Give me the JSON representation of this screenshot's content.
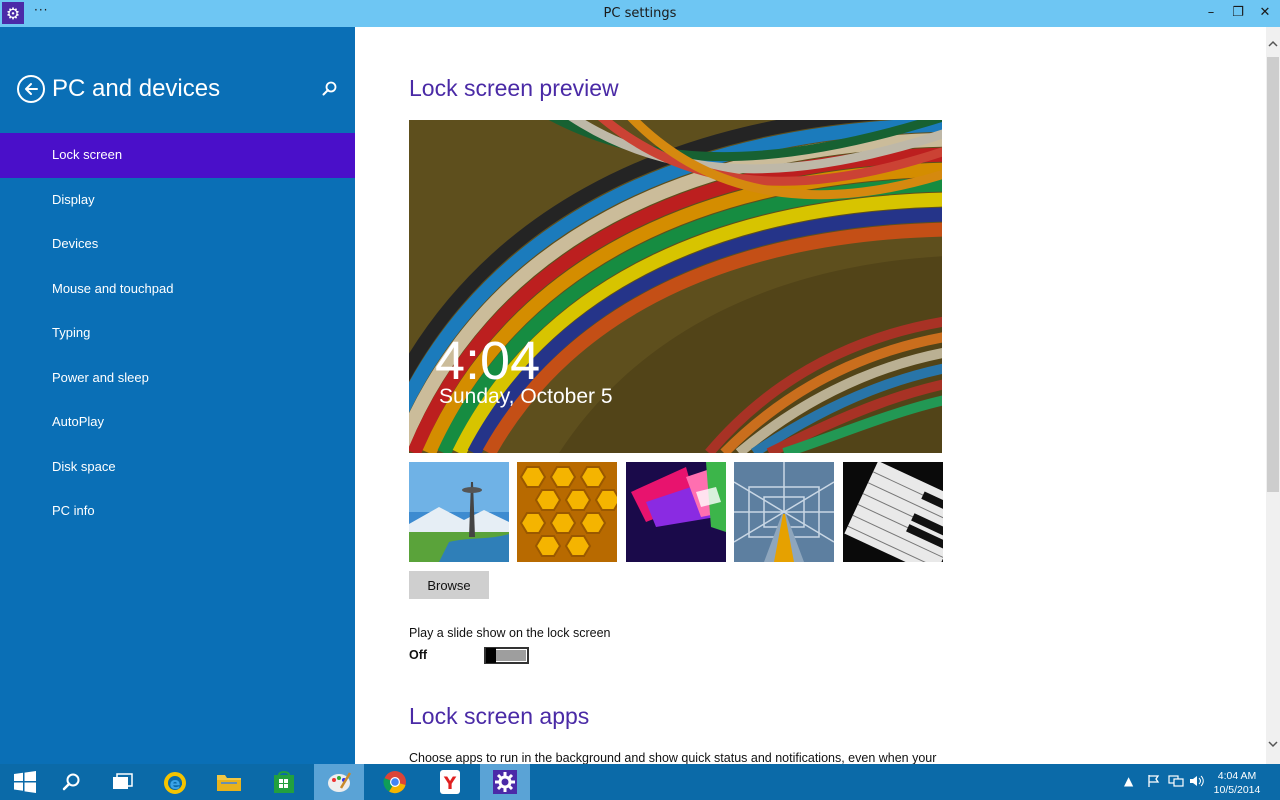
{
  "window": {
    "title": "PC settings",
    "menu_glyph": "···",
    "minimize_glyph": "–",
    "restore_glyph": "❐",
    "close_glyph": "✕"
  },
  "sidebar": {
    "title": "PC and devices",
    "items": [
      {
        "label": "Lock screen",
        "active": true
      },
      {
        "label": "Display"
      },
      {
        "label": "Devices"
      },
      {
        "label": "Mouse and touchpad"
      },
      {
        "label": "Typing"
      },
      {
        "label": "Power and sleep"
      },
      {
        "label": "AutoPlay"
      },
      {
        "label": "Disk space"
      },
      {
        "label": "PC info"
      }
    ]
  },
  "main": {
    "preview_heading": "Lock screen preview",
    "preview_time": "4:04",
    "preview_date": "Sunday, October 5",
    "browse_label": "Browse",
    "slideshow_label": "Play a slide show on the lock screen",
    "slideshow_state": "Off",
    "apps_heading": "Lock screen apps",
    "apps_description": "Choose apps to run in the background and show quick status and notifications, even when your"
  },
  "taskbar": {
    "clock_time": "4:04 AM",
    "clock_date": "10/5/2014"
  },
  "colors": {
    "sidebar_bg": "#0a6fb6",
    "sidebar_active": "#4a0fc9",
    "heading": "#4a2aa6",
    "titlebar": "#6ec6f3",
    "taskbar": "#0b6aa8"
  }
}
